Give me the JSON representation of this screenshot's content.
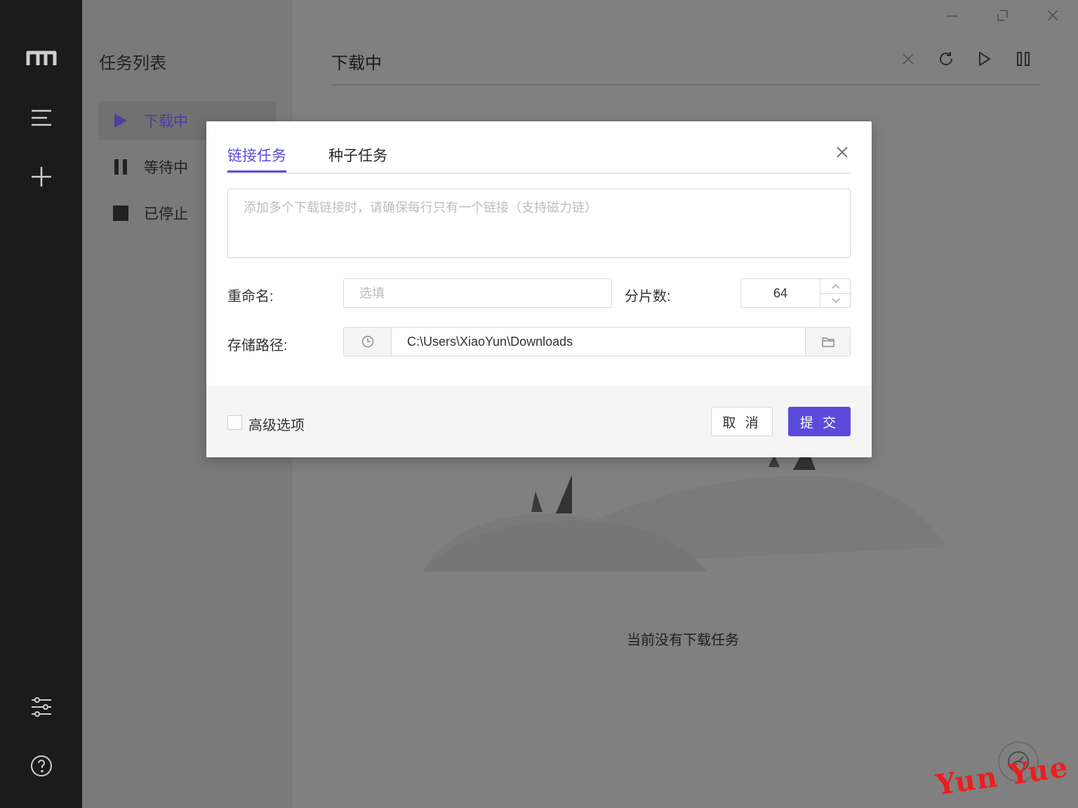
{
  "sidebar": {
    "title": "任务列表",
    "items": [
      {
        "label": "下载中",
        "icon": "play-icon"
      },
      {
        "label": "等待中",
        "icon": "pause-icon"
      },
      {
        "label": "已停止",
        "icon": "stop-icon"
      }
    ]
  },
  "main": {
    "title": "下载中",
    "empty_text": "当前没有下载任务"
  },
  "dialog": {
    "tabs": [
      {
        "label": "链接任务"
      },
      {
        "label": "种子任务"
      }
    ],
    "url_placeholder": "添加多个下载链接时，请确保每行只有一个链接（支持磁力链）",
    "rename_label": "重命名:",
    "rename_placeholder": "选填",
    "split_label": "分片数:",
    "split_value": "64",
    "path_label": "存储路径:",
    "path_value": "C:\\Users\\XiaoYun\\Downloads",
    "advanced_label": "高级选项",
    "cancel_label": "取 消",
    "submit_label": "提 交"
  },
  "watermark": "Yun Yue",
  "colors": {
    "accent": "#5b4bdb",
    "rail": "#1b1b1b"
  }
}
